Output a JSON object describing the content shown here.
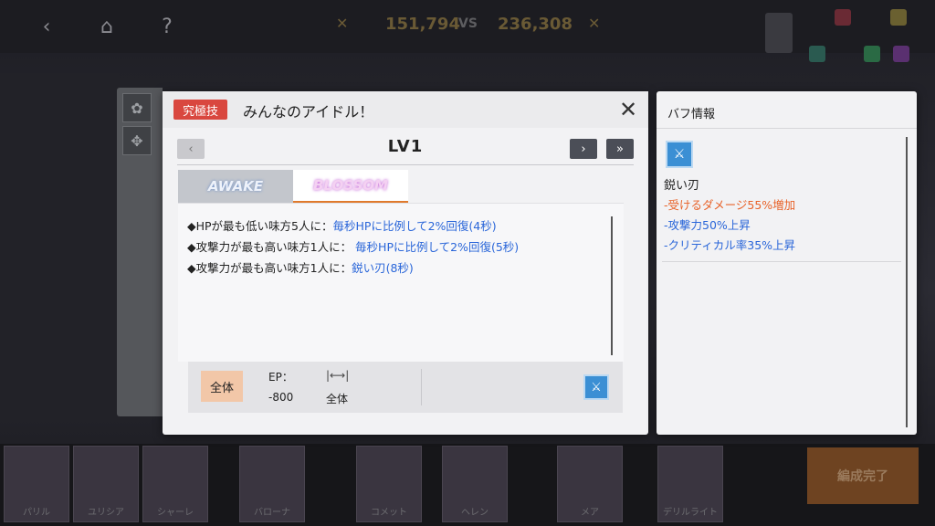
{
  "background": {
    "score_left": "151,794",
    "vs_label": "VS",
    "score_right": "236,308",
    "roster_names": [
      "パリル",
      "ユリシア",
      "シャーレ",
      "バローナ",
      "コメット",
      "ヘレン",
      "メア",
      "デリルライト"
    ],
    "confirm_label": "編成完了"
  },
  "skill_dialog": {
    "tag": "究極技",
    "title": "みんなのアイドル！",
    "close_icon": "close-icon",
    "level": "LV1",
    "nav": {
      "prev": "‹",
      "next": "›",
      "last": "»"
    },
    "tabs": [
      {
        "label": "AWAKE",
        "active": false
      },
      {
        "label": "BLOSSOM",
        "active": true
      }
    ],
    "descriptions": [
      {
        "prefix": "◆HPが最も低い味方5人に：",
        "effect": "毎秒HPに比例して2%回復(4秒)"
      },
      {
        "prefix": "◆攻撃力が最も高い味方1人に： ",
        "effect": "毎秒HPに比例して2%回復(5秒)"
      },
      {
        "prefix": "◆攻撃力が最も高い味方1人に：",
        "effect": "鋭い刃(8秒)"
      }
    ],
    "info": {
      "range_chip": "全体",
      "ep_label": "EP：",
      "ep_value": "-800",
      "range_icon": "|⟷|",
      "range_value": "全体"
    }
  },
  "buff_panel": {
    "title": "バフ情報",
    "buff_name": "鋭い刃",
    "effects": [
      {
        "text": "-受けるダメージ55%増加",
        "color": "#e8632a"
      },
      {
        "text": "-攻撃力50%上昇",
        "color": "#2a66d9"
      },
      {
        "text": "-クリティカル率35%上昇",
        "color": "#2a66d9"
      }
    ]
  }
}
